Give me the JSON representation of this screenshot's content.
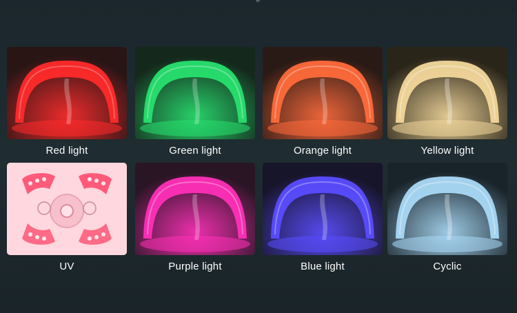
{
  "panels": [
    {
      "label": "Red light",
      "color": "#ff2a2a"
    },
    {
      "label": "Green light",
      "color": "#27e06e"
    },
    {
      "label": "Orange light",
      "color": "#ff6a3a"
    },
    {
      "label": "Yellow light",
      "color": "#f3d79a"
    },
    {
      "label": "UV",
      "color": "#ffd0d8"
    },
    {
      "label": "Purple light",
      "color": "#ff2fb8"
    },
    {
      "label": "Blue light",
      "color": "#5a4cff"
    },
    {
      "label": "Cyclic",
      "color": "#a9d9f5"
    }
  ]
}
